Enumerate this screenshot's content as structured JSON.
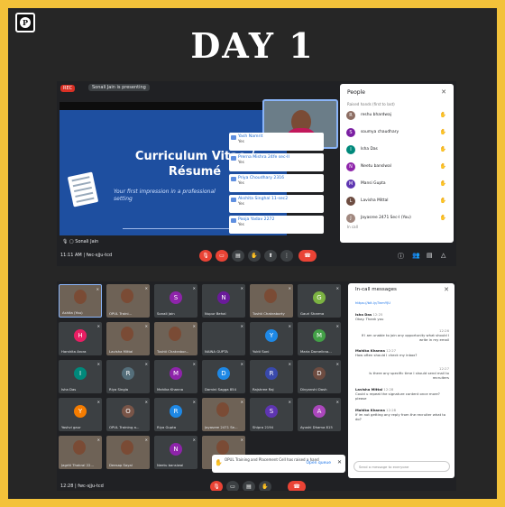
{
  "title": "DAY 1",
  "logo_letter": "P",
  "colors": {
    "frame": "#f3c23a",
    "bg": "#262626",
    "meet_bg": "#202124",
    "accent": "#8ab4f8",
    "red": "#ea4335"
  },
  "meet1": {
    "rec": "REC",
    "presenting": "Sonali Jain is presenting",
    "slide": {
      "title_line1": "Curriculum Vitae /",
      "title_line2": "Résumé",
      "subtitle": "Your first impression in a professional setting",
      "presenter": "Sonali Jain"
    },
    "camtile_name": "Kratikwar Kaushik Training and Placement...",
    "chat": [
      {
        "name": "Yash Namrit",
        "text": "Yes"
      },
      {
        "name": "Prerna Mishra 24fe sec-II",
        "text": "Yes"
      },
      {
        "name": "Priya Choudhary 2316",
        "text": "Yes"
      },
      {
        "name": "Akshita Singhal 11-sec2",
        "text": "Yes"
      },
      {
        "name": "Pooja Yadav 2272",
        "text": "Yes"
      }
    ],
    "people": {
      "heading": "People",
      "caption": "Raised hands (first to last)",
      "in_call": "In call",
      "rows": [
        {
          "initial": "R",
          "name": "reshu bhardwaj",
          "color": "#8d6e63"
        },
        {
          "initial": "S",
          "name": "soumya chaudhary",
          "color": "#7b1fa2"
        },
        {
          "initial": "I",
          "name": "Isha Das",
          "color": "#00897b"
        },
        {
          "initial": "N",
          "name": "Neetu banslwal",
          "color": "#8e24aa"
        },
        {
          "initial": "M",
          "name": "Mansi Gupta",
          "color": "#5e35b1"
        },
        {
          "initial": "L",
          "name": "Lavisha Mittal",
          "color": "#6d4c41"
        },
        {
          "initial": "J",
          "name": "Jayasree 2471 Sec-I (You)",
          "color": "#a1887f"
        }
      ]
    },
    "time": "11:11 AM  |  fwc-sjju-tcd"
  },
  "meet2": {
    "tiles": [
      {
        "name": "Ashita (You)",
        "initial": "",
        "color": "#6e6256",
        "photo": true,
        "hl": true
      },
      {
        "name": "OPUL Traini...",
        "initial": "",
        "color": "#6e6256",
        "photo": true,
        "hl": false
      },
      {
        "name": "Sonali Jain",
        "initial": "S",
        "color": "#8e24aa",
        "photo": false,
        "hl": false
      },
      {
        "name": "Nupur Behal",
        "initial": "N",
        "color": "#6a1b9a",
        "photo": false,
        "hl": false
      },
      {
        "name": "Tushti Chakraborty",
        "initial": "",
        "color": "#6e6256",
        "photo": true,
        "hl": false
      },
      {
        "name": "Gauri Sharma",
        "initial": "G",
        "color": "#7cb342",
        "photo": false,
        "hl": false
      },
      {
        "name": "Harshita Arora",
        "initial": "H",
        "color": "#e91e63",
        "photo": false,
        "hl": false
      },
      {
        "name": "Lavisha Mittal",
        "initial": "",
        "color": "#6e6256",
        "photo": true,
        "hl": false
      },
      {
        "name": "Tushti Chakrabor...",
        "initial": "",
        "color": "#6e6256",
        "photo": true,
        "hl": false
      },
      {
        "name": "NAINA GUPTA",
        "initial": "",
        "color": "#3c4043",
        "photo": false,
        "hl": false
      },
      {
        "name": "Yukti Soni",
        "initial": "Y",
        "color": "#1e88e5",
        "photo": false,
        "hl": false
      },
      {
        "name": "Maria Darnelkna...",
        "initial": "M",
        "color": "#43a047",
        "photo": false,
        "hl": false
      },
      {
        "name": "Isha Das",
        "initial": "I",
        "color": "#00897b",
        "photo": false,
        "hl": false
      },
      {
        "name": "Riya Singla",
        "initial": "R",
        "color": "#546e7a",
        "photo": false,
        "hl": false
      },
      {
        "name": "Mahika Khanna",
        "initial": "M",
        "color": "#8e24aa",
        "photo": false,
        "hl": false
      },
      {
        "name": "Damini Sagga 854",
        "initial": "D",
        "color": "#1e88e5",
        "photo": false,
        "hl": false
      },
      {
        "name": "Rajshree Raj",
        "initial": "R",
        "color": "#3949ab",
        "photo": false,
        "hl": false
      },
      {
        "name": "Divyanshi Dash",
        "initial": "D",
        "color": "#6d4c41",
        "photo": false,
        "hl": false
      },
      {
        "name": "Yashvi gaur",
        "initial": "Y",
        "color": "#f57c00",
        "photo": false,
        "hl": false
      },
      {
        "name": "OPUL Training a...",
        "initial": "O",
        "color": "#795548",
        "photo": false,
        "hl": false
      },
      {
        "name": "Riya Gupta",
        "initial": "R",
        "color": "#1e88e5",
        "photo": false,
        "hl": false
      },
      {
        "name": "Jayasree 2471 Se...",
        "initial": "",
        "color": "#6e6256",
        "photo": true,
        "hl": false
      },
      {
        "name": "Shipra 2194",
        "initial": "S",
        "color": "#5e35b1",
        "photo": false,
        "hl": false
      },
      {
        "name": "Ayushi Dhama 815",
        "initial": "A",
        "color": "#ab47bc",
        "photo": false,
        "hl": false
      },
      {
        "name": "Jagriti Thakral 22...",
        "initial": "",
        "color": "#6e6256",
        "photo": true,
        "hl": false
      },
      {
        "name": "Deesap Sayal",
        "initial": "",
        "color": "#6e6256",
        "photo": true,
        "hl": false
      },
      {
        "name": "Neetu banslwal",
        "initial": "N",
        "color": "#8e24aa",
        "photo": false,
        "hl": false
      },
      {
        "name": "",
        "initial": "",
        "color": "#6e6256",
        "photo": true,
        "hl": false
      }
    ],
    "messages": {
      "heading": "In-call messages",
      "items": [
        {
          "name": "",
          "time": "",
          "text": "https://bit.ly/3nmYJU",
          "right": false
        },
        {
          "name": "Isha Das",
          "time": "12:25",
          "text": "Okay. Thank you",
          "right": false
        },
        {
          "name": "",
          "time": "12:26",
          "text": "If I am unable to join any opportunity what should I write in my email",
          "right": true
        },
        {
          "name": "Mahika Khanna",
          "time": "12:27",
          "text": "How often should I check my inbox?",
          "right": false
        },
        {
          "name": "",
          "time": "12:27",
          "text": "Is there any specific time I should send mail to recruiters",
          "right": true
        },
        {
          "name": "Lavisha Mittal",
          "time": "12:28",
          "text": "Could u repeat the signature content once more? please",
          "right": false
        },
        {
          "name": "Mahika Khanna",
          "time": "12:28",
          "text": "If im not getting any reply from the recruiter what to do?",
          "right": false
        }
      ],
      "placeholder": "Send a message to everyone"
    },
    "toast": {
      "text": "OPUL Training and Placement Cell has raised a hand",
      "action": "Open queue"
    },
    "time": "12:28  |  fwc-sjju-tcd"
  }
}
